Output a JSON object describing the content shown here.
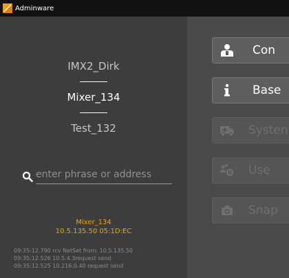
{
  "window": {
    "title": "Adminware"
  },
  "devices": [
    {
      "name": "IMX2_Dirk"
    },
    {
      "name": "Mixer_134"
    },
    {
      "name": "Test_132"
    }
  ],
  "search": {
    "placeholder": "enter phrase or address",
    "value": ""
  },
  "selected_info": {
    "name": "Mixer_134",
    "details": "10.5.135.50  05:1D:EC"
  },
  "log": [
    "09:35:12.790  rcv NetSet from: 10.5.135.50",
    "09:35:12.526  10.5.4.3request send",
    "09:35:12.525  10.216.0.40 request send"
  ],
  "menu": [
    {
      "label": "Con",
      "icon": "operator-icon",
      "enabled": true
    },
    {
      "label": "Base",
      "icon": "info-icon",
      "enabled": true
    },
    {
      "label": "Systen",
      "icon": "ambulance-icon",
      "enabled": false
    },
    {
      "label": "Use",
      "icon": "users-gear-icon",
      "enabled": false
    },
    {
      "label": "Snap",
      "icon": "camera-icon",
      "enabled": false
    }
  ],
  "colors": {
    "accent": "#f0a500",
    "titlebar": "#111111",
    "left_panel": "#3d3d3d",
    "right_panel": "#4a4a4a"
  }
}
